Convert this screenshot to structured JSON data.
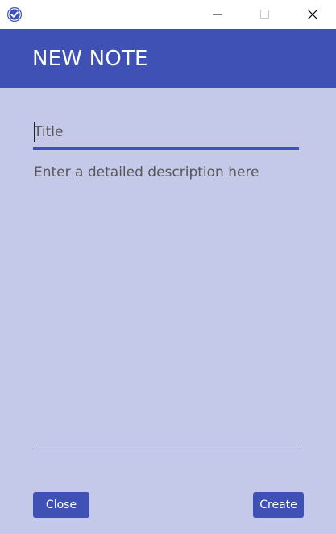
{
  "window": {
    "icons": {
      "app": "check-circle-icon",
      "minimize": "minimize-icon",
      "maximize": "maximize-icon",
      "close": "close-icon"
    }
  },
  "header": {
    "title": "NEW NOTE"
  },
  "form": {
    "title_field": {
      "value": "",
      "placeholder": "Title"
    },
    "description_field": {
      "value": "",
      "placeholder": "Enter a detailed description here"
    }
  },
  "actions": {
    "close_label": "Close",
    "create_label": "Create"
  },
  "colors": {
    "accent": "#3f51b5",
    "background": "#c5c9e9",
    "titlebar": "#ffffff"
  }
}
